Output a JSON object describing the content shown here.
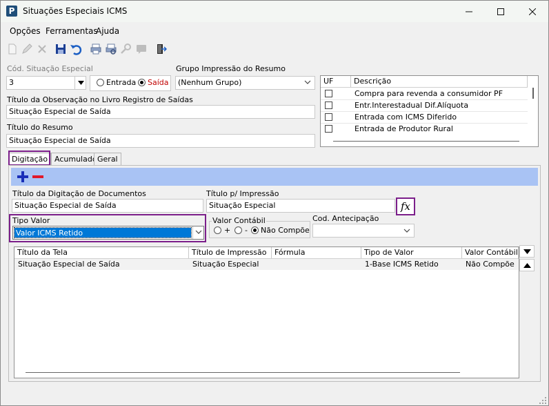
{
  "window": {
    "title": "Situações Especiais ICMS"
  },
  "menu": [
    "Opções",
    "Ferramentas",
    "Ajuda"
  ],
  "form": {
    "cod_label": "Cód. Situação Especial",
    "cod_value": "3",
    "radio_entrada": "Entrada",
    "radio_saida": "Saída",
    "grupo_label": "Grupo Impressão do Resumo",
    "grupo_value": "(Nenhum Grupo)",
    "obs_label": "Título da Observação no Livro Registro de Saídas",
    "obs_value": "Situação Especial de Saída",
    "resumo_label": "Título do Resumo",
    "resumo_value": "Situação Especial de Saída"
  },
  "uf_grid": {
    "headers": [
      "UF",
      "Descrição"
    ],
    "rows": [
      "Compra para revenda a consumidor PF",
      "Entr.Interestadual Dif.Alíquota",
      "Entrada com ICMS Diferido",
      "Entrada de Produtor Rural"
    ]
  },
  "tabs": [
    "Digitação",
    "Acumulado",
    "Geral"
  ],
  "digitacao": {
    "titulo_label": "Título da Digitação de Documentos",
    "titulo_value": "Situação Especial de Saída",
    "impressao_label": "Título p/ Impressão",
    "impressao_value": "Situação Especial",
    "fx_label": "fx",
    "tipo_label": "Tipo Valor",
    "tipo_value": "Valor ICMS Retido",
    "valor_contabil_label": "Valor Contábil",
    "vc_plus": "+",
    "vc_minus": "-",
    "vc_nao": "Não Compõe",
    "antecipacao_label": "Cod. Antecipação"
  },
  "main_grid": {
    "headers": [
      "Título da Tela",
      "Título de Impressão",
      "Fórmula",
      "Tipo de Valor",
      "Valor Contábil"
    ],
    "rows": [
      [
        "Situação Especial de Saída",
        "Situação Especial",
        "",
        "1-Base ICMS Retido",
        "Não Compõe"
      ]
    ]
  },
  "colors": {
    "accent": "#7b1e8a",
    "bluebar": "#a9c3f4",
    "selection": "#0078d7"
  }
}
